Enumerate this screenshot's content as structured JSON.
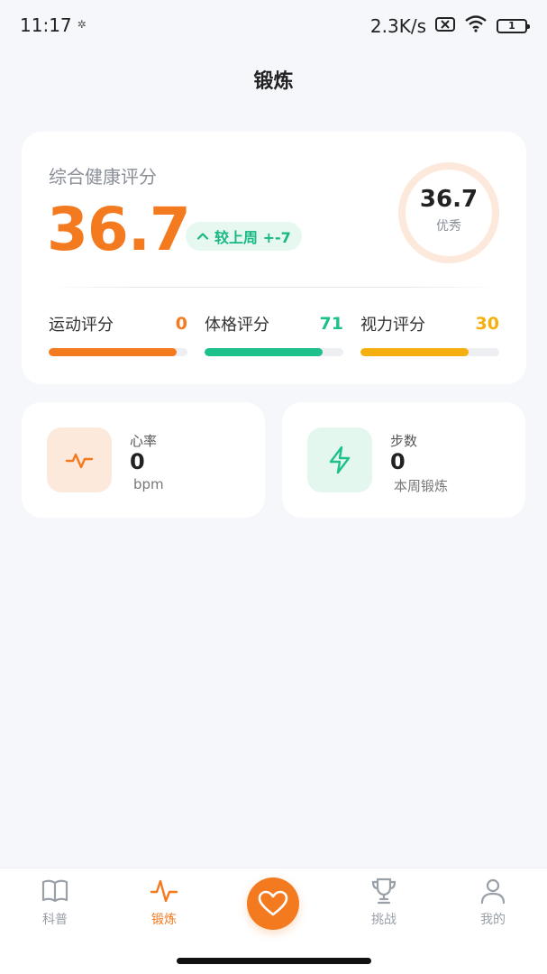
{
  "status_bar": {
    "time": "11:17",
    "network_speed": "2.3K/s",
    "battery_level": "1",
    "icons": [
      "gear-icon",
      "no-sim-icon",
      "wifi-icon",
      "battery-icon"
    ]
  },
  "header": {
    "title": "锻炼"
  },
  "score_card": {
    "label": "综合健康评分",
    "value": "36.7",
    "trend": "较上周 +-7",
    "ring_value": "36.7",
    "ring_level": "优秀",
    "ring_progress": 0.367,
    "sub_scores": [
      {
        "name": "运动评分",
        "value": "0",
        "progress": 0.92,
        "color": "#f47a20"
      },
      {
        "name": "体格评分",
        "value": "71",
        "progress": 0.85,
        "color": "#1ec08b"
      },
      {
        "name": "视力评分",
        "value": "30",
        "progress": 0.78,
        "color": "#f5b00f"
      }
    ]
  },
  "metrics": [
    {
      "label": "心率",
      "value": "0",
      "unit": "bpm",
      "icon": "heartbeat-icon",
      "color": "#f47a20",
      "bg": "#fde9dc"
    },
    {
      "label": "步数",
      "value": "0",
      "unit": "本周锻炼",
      "icon": "lightning-icon",
      "color": "#1ec08b",
      "bg": "#e3f7ef"
    }
  ],
  "bottom_nav": {
    "items": [
      {
        "label": "科普",
        "icon": "book-icon",
        "active": false
      },
      {
        "label": "锻炼",
        "icon": "pulse-icon",
        "active": true
      },
      {
        "label": "挑战",
        "icon": "trophy-icon",
        "active": false
      },
      {
        "label": "我的",
        "icon": "user-icon",
        "active": false
      }
    ],
    "center_icon": "heart-icon"
  },
  "colors": {
    "accent": "#f47a20",
    "green": "#1ec08b",
    "yellow": "#f5b00f",
    "background": "#f6f7fb"
  }
}
